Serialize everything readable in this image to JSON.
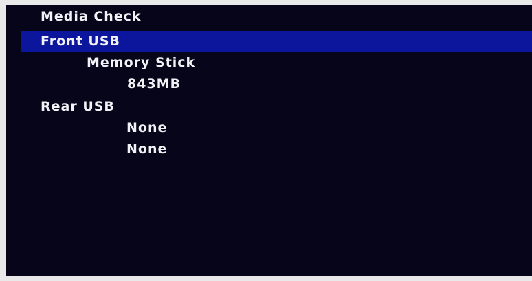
{
  "screen": {
    "title": "Media Check",
    "front_usb": {
      "label": "Front USB",
      "device": "Memory Stick",
      "size": "843MB"
    },
    "rear_usb": {
      "label": "Rear USB",
      "slot1": "None",
      "slot2": "None"
    }
  },
  "colors": {
    "background": "#07051a",
    "selection": "#0b169c",
    "text": "#f2f2f6"
  }
}
